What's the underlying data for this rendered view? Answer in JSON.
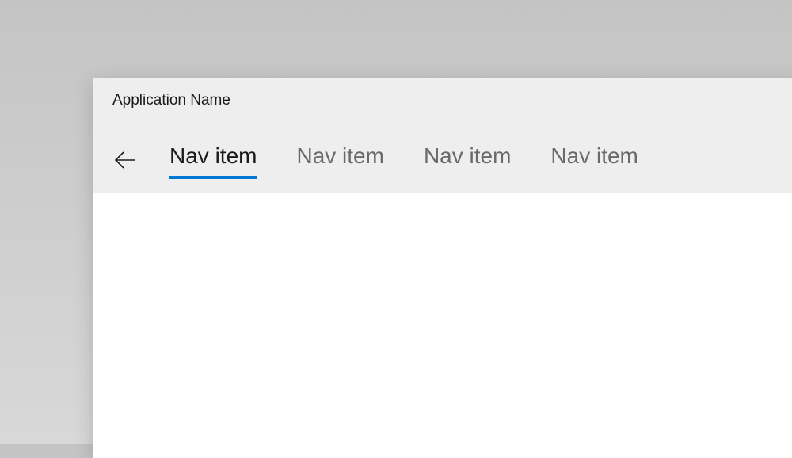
{
  "app": {
    "title": "Application Name"
  },
  "nav": {
    "tabs": [
      {
        "label": "Nav item",
        "active": true
      },
      {
        "label": "Nav item",
        "active": false
      },
      {
        "label": "Nav item",
        "active": false
      },
      {
        "label": "Nav item",
        "active": false
      }
    ]
  },
  "colors": {
    "accent": "#0078d4",
    "header_bg": "#eeeeee",
    "text_primary": "#1a1a1a",
    "text_secondary": "#6a6a6a"
  }
}
